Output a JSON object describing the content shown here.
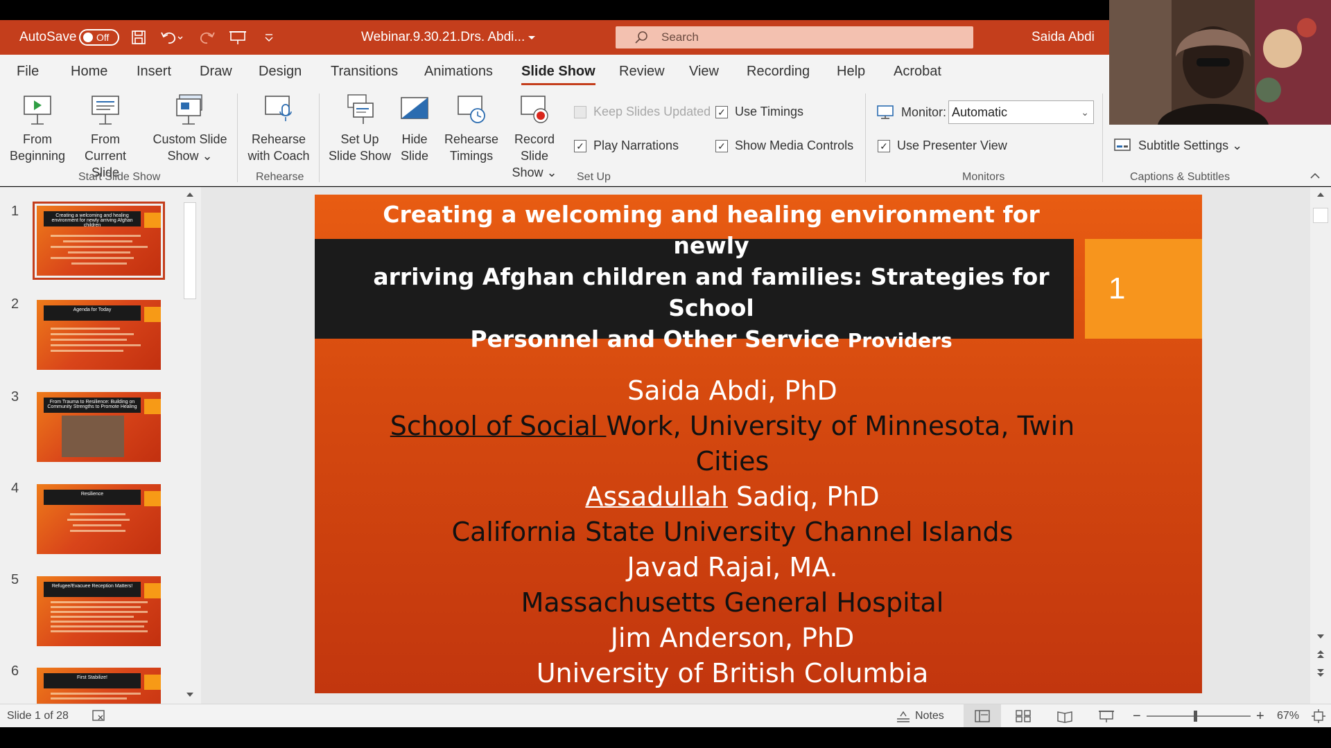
{
  "titlebar": {
    "autosave_label": "AutoSave",
    "autosave_state": "Off",
    "doc_title": "Webinar.9.30.21.Drs. Abdi...",
    "search_placeholder": "Search",
    "user_name": "Saida Abdi",
    "accent_color": "#c43e1c"
  },
  "ribbon_tabs": [
    "File",
    "Home",
    "Insert",
    "Draw",
    "Design",
    "Transitions",
    "Animations",
    "Slide Show",
    "Review",
    "View",
    "Recording",
    "Help",
    "Acrobat"
  ],
  "active_tab": "Slide Show",
  "ribbon": {
    "from_beginning": [
      "From",
      "Beginning"
    ],
    "from_current": [
      "From",
      "Current Slide"
    ],
    "custom_slide_show": [
      "Custom Slide",
      "Show ⌄"
    ],
    "group_start": "Start Slide Show",
    "rehearse_coach": [
      "Rehearse",
      "with Coach"
    ],
    "group_rehearse": "Rehearse",
    "setup_show": [
      "Set Up",
      "Slide Show"
    ],
    "hide_slide": [
      "Hide",
      "Slide"
    ],
    "rehearse_timings": [
      "Rehearse",
      "Timings"
    ],
    "record_show": [
      "Record Slide",
      "Show ⌄"
    ],
    "keep_updated": "Keep Slides Updated",
    "play_narrations": "Play Narrations",
    "use_timings": "Use Timings",
    "show_media": "Show Media Controls",
    "group_setup": "Set Up",
    "monitor_label": "Monitor:",
    "monitor_value": "Automatic",
    "presenter_view": "Use Presenter View",
    "group_monitors": "Monitors",
    "subtitle_settings": "Subtitle Settings ⌄",
    "group_captions": "Captions & Subtitles"
  },
  "thumbnails": [
    {
      "num": "1",
      "title": "Creating a welcoming and healing environment for newly arriving Afghan children"
    },
    {
      "num": "2",
      "title": "Agenda for Today"
    },
    {
      "num": "3",
      "title": "From Trauma to Resilience: Building on Community Strengths to Promote Healing"
    },
    {
      "num": "4",
      "title": "Resilience"
    },
    {
      "num": "5",
      "title": "Refugee/Evacuee Reception Matters!"
    },
    {
      "num": "6",
      "title": "First Stabilize!"
    }
  ],
  "slide": {
    "title_line1": "Creating a welcoming and healing environment for newly",
    "title_line2": "arriving Afghan children and families: Strategies for School",
    "title_line3": "Personnel and Other Service",
    "title_small": "Providers",
    "number": "1",
    "l1": "Saida Abdi, PhD",
    "l2a": "School of Social ",
    "l2b": "Work, University of Minnesota, Twin",
    "l3": "Cities",
    "l4a": "Assadullah",
    "l4b": " Sadiq, PhD",
    "l5": "California State University Channel Islands",
    "l6": "Javad Rajai, MA.",
    "l7": "Massachusetts General Hospital",
    "l8": "Jim Anderson, PhD",
    "l9": "University of British Columbia"
  },
  "status": {
    "slide_count": "Slide 1 of 28",
    "notes": "Notes",
    "zoom": "67%"
  }
}
